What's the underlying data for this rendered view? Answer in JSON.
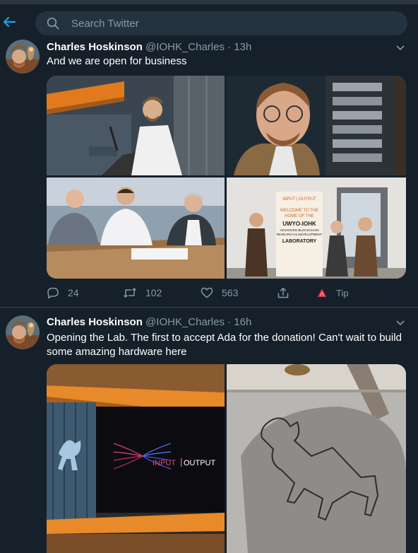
{
  "search": {
    "placeholder": "Search Twitter"
  },
  "tweets": [
    {
      "name": "Charles Hoskinson",
      "handle": "@IOHK_Charles · 13h",
      "text": "And we are open for business",
      "actions": {
        "reply_count": "24",
        "retweet_count": "102",
        "like_count": "563",
        "tip_label": "Tip"
      }
    },
    {
      "name": "Charles Hoskinson",
      "handle": "@IOHK_Charles · 16h",
      "text": "Opening the Lab. The first to accept Ada for the donation! Can't wait to build some amazing hardware here"
    }
  ],
  "photo_text": {
    "sign_logo": "INPUT | OUTPUT",
    "sign_lines": [
      "WELCOME TO THE",
      "HOME OF THE",
      "UWYO-IOHK",
      "ADVANCED BLOCKCHAIN",
      "RESEARCH & DEVELOPMENT",
      "LABORATORY"
    ],
    "wall_logo_left": "INPUT",
    "wall_logo_right": "OUTPUT"
  },
  "colors": {
    "background": "#15202b",
    "accent": "#1da1f2",
    "muted": "#8899a6",
    "divider": "#38444d",
    "search_bg": "#253341"
  },
  "icons": [
    "back-arrow-icon",
    "search-icon",
    "chevron-down-icon",
    "reply-icon",
    "retweet-icon",
    "like-icon",
    "share-icon",
    "tip-icon"
  ]
}
